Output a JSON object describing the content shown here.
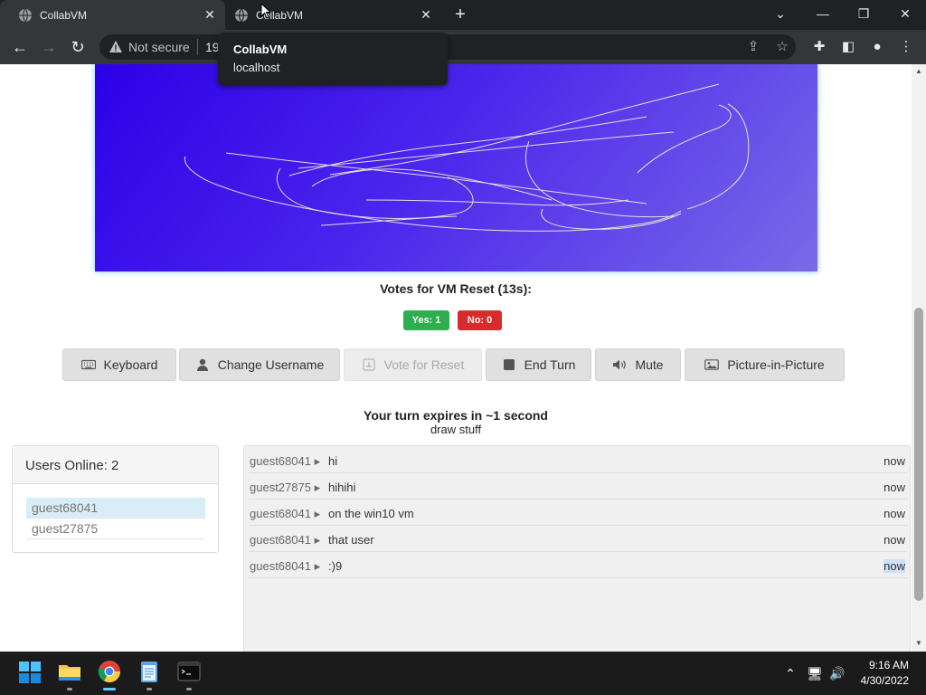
{
  "browser": {
    "tabs": [
      {
        "title": "CollabVM",
        "active": true
      },
      {
        "title": "CollabVM",
        "active": false
      }
    ],
    "security_label": "Not secure",
    "url": "19",
    "tooltip": {
      "title": "CollabVM",
      "host": "localhost"
    },
    "icons": [
      "globe-icon",
      "close-icon",
      "new-tab-icon",
      "back-icon",
      "forward-icon",
      "reload-icon",
      "warning-icon",
      "share-icon",
      "bookmark-star-icon",
      "extensions-icon",
      "side-panel-icon",
      "profile-icon",
      "menu-icon"
    ]
  },
  "vm": {
    "votes_title": "Votes for VM Reset (13s):",
    "yes_label": "Yes: 1",
    "no_label": "No: 0",
    "colors": {
      "yes": "#2eae4e",
      "no": "#d82c2c",
      "screen_start": "#2c00e8",
      "screen_end": "#7a6ae8"
    }
  },
  "controls": {
    "keyboard": "Keyboard",
    "change_username": "Change Username",
    "vote_reset": "Vote for Reset",
    "end_turn": "End Turn",
    "mute": "Mute",
    "pip": "Picture-in-Picture"
  },
  "turn": {
    "status": "Your turn expires in ~1 second",
    "note": "draw stuff"
  },
  "users": {
    "header": "Users Online: 2",
    "list": [
      "guest68041",
      "guest27875"
    ]
  },
  "chat": {
    "messages": [
      {
        "user": "guest68041",
        "text": "hi",
        "time": "now"
      },
      {
        "user": "guest27875",
        "text": "hihihi",
        "time": "now"
      },
      {
        "user": "guest68041",
        "text": "on the win10 vm",
        "time": "now"
      },
      {
        "user": "guest68041",
        "text": "that user",
        "time": "now"
      },
      {
        "user": "guest68041",
        "text": ":)9",
        "time": "now"
      }
    ]
  },
  "taskbar": {
    "time": "9:16 AM",
    "date": "4/30/2022",
    "apps": [
      "start-icon",
      "file-explorer-icon",
      "chrome-icon",
      "notepad-icon",
      "terminal-icon"
    ]
  }
}
